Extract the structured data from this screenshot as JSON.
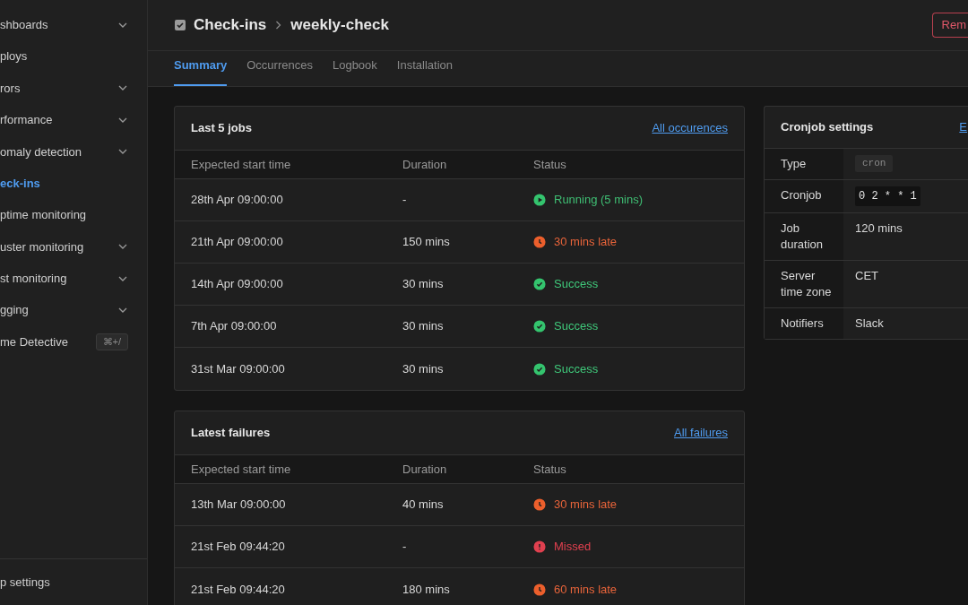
{
  "sidebar": {
    "items": [
      {
        "label": "shboards",
        "expandable": true,
        "selected": false
      },
      {
        "label": "ploys",
        "expandable": false,
        "selected": false
      },
      {
        "label": "rors",
        "expandable": true,
        "selected": false
      },
      {
        "label": "rformance",
        "expandable": true,
        "selected": false
      },
      {
        "label": "omaly detection",
        "expandable": true,
        "selected": false
      },
      {
        "label": "eck-ins",
        "expandable": false,
        "selected": true
      },
      {
        "label": "ptime monitoring",
        "expandable": false,
        "selected": false
      },
      {
        "label": "uster monitoring",
        "expandable": true,
        "selected": false
      },
      {
        "label": "st monitoring",
        "expandable": true,
        "selected": false
      },
      {
        "label": "gging",
        "expandable": true,
        "selected": false
      },
      {
        "label": "me Detective",
        "expandable": false,
        "selected": false,
        "shortcut": "⌘+/"
      }
    ],
    "footer": "p settings"
  },
  "header": {
    "breadcrumb": [
      "Check-ins",
      "weekly-check"
    ],
    "button": "Rem"
  },
  "tabs": [
    {
      "label": "Summary",
      "selected": true
    },
    {
      "label": "Occurrences",
      "selected": false
    },
    {
      "label": "Logbook",
      "selected": false
    },
    {
      "label": "Installation",
      "selected": false
    }
  ],
  "cards": [
    {
      "title": "Last 5 jobs",
      "link": "All occurences",
      "columns": [
        "Expected start time",
        "Duration",
        "Status"
      ],
      "rows": [
        {
          "start": "28th Apr 09:00:00",
          "duration": "-",
          "status": "Running (5 mins)",
          "kind": "running"
        },
        {
          "start": "21th Apr 09:00:00",
          "duration": "150 mins",
          "status": "30 mins late",
          "kind": "late"
        },
        {
          "start": "14th Apr 09:00:00",
          "duration": "30 mins",
          "status": "Success",
          "kind": "success"
        },
        {
          "start": "7th Apr 09:00:00",
          "duration": "30 mins",
          "status": "Success",
          "kind": "success"
        },
        {
          "start": "31st Mar 09:00:00",
          "duration": "30 mins",
          "status": "Success",
          "kind": "success"
        }
      ]
    },
    {
      "title": "Latest failures",
      "link": "All failures",
      "columns": [
        "Expected start time",
        "Duration",
        "Status"
      ],
      "rows": [
        {
          "start": "13th Mar 09:00:00",
          "duration": "40 mins",
          "status": "30 mins late",
          "kind": "late"
        },
        {
          "start": "21st Feb 09:44:20",
          "duration": "-",
          "status": "Missed",
          "kind": "missed"
        },
        {
          "start": "21st Feb 09:44:20",
          "duration": "180 mins",
          "status": "60 mins late",
          "kind": "late"
        }
      ]
    }
  ],
  "settings": {
    "title": "Cronjob settings",
    "link": "E",
    "rows": [
      {
        "label": "Type",
        "value": "cron",
        "kind": "tag"
      },
      {
        "label": "Cronjob",
        "value": "0 2 * * 1",
        "kind": "code"
      },
      {
        "label": "Job duration",
        "value": "120 mins",
        "kind": "text"
      },
      {
        "label": "Server time zone",
        "value": "CET",
        "kind": "text"
      },
      {
        "label": "Notifiers",
        "value": "Slack",
        "kind": "text"
      }
    ]
  }
}
